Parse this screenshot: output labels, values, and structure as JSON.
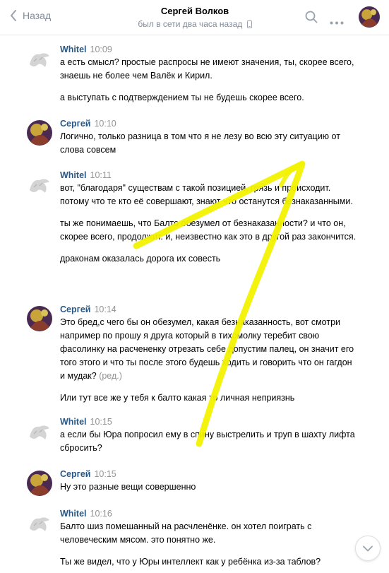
{
  "header": {
    "back_label": "Назад",
    "title": "Сергей Волков",
    "status": "был в сети два часа назад"
  },
  "messages": [
    {
      "author": "Whitel",
      "time": "10:09",
      "paragraphs": [
        "а есть смысл? простые распросы не имеют значения, ты, скорее всего, знаешь не более чем Валёк и Кирил.",
        "а выступать с подтверждением ты не будешь скорее всего."
      ]
    },
    {
      "author": "Сергей",
      "time": "10:10",
      "paragraphs": [
        "Логично, только разница в том что я не лезу во всю эту ситуацию от слова совсем"
      ]
    },
    {
      "author": "Whitel",
      "time": "10:11",
      "paragraphs": [
        "вот, \"благодаря\" существам с такой позицией, грязь и происходит. потому что те кто её совершают, знают что останутся безнаказанными.",
        "ты же понимаешь, что Балто обезумел от безнаказанности? и что он, скорее всего, продолжит. и, неизвестно как это в другой раз закончится.",
        "драконам оказалась дорога их совесть"
      ]
    },
    {
      "author": "Сергей",
      "time": "10:14",
      "paragraphs": [
        "Это бред,с чего бы он обезумел, какая безнаказанность, вот смотри например по прошу я друга который в тихомолку теребит свою фасолинку на расчененку отрезать себе допустим палец, он значит его того этого и что ты после этого будешь ходить и говорить что он гагдон и мудак?",
        "Или тут все же у тебя к балто какая то личная неприязнь"
      ],
      "edited": "(ред.)"
    },
    {
      "author": "Whitel",
      "time": "10:15",
      "paragraphs": [
        "а если бы Юра попросил ему в спину выстрелить и труп в шахту лифта сбросить?"
      ]
    },
    {
      "author": "Сергей",
      "time": "10:15",
      "paragraphs": [
        "Ну это разные вещи совершенно"
      ]
    },
    {
      "author": "Whitel",
      "time": "10:16",
      "paragraphs": [
        "Балто шиз помешанный на расчленёнке. он хотел поиграть с человеческим мясом. это понятно же.",
        "Ты же видел, что у Юры интеллект как у ребёнка из-за таблов?"
      ]
    }
  ],
  "colors": {
    "link": "#2a5885",
    "muted": "#939393",
    "header_muted": "#818c99",
    "annotation": "#f2f200"
  },
  "icons": [
    "chevron-left-icon",
    "phone-icon",
    "search-icon",
    "more-icon",
    "chevron-down-icon"
  ]
}
